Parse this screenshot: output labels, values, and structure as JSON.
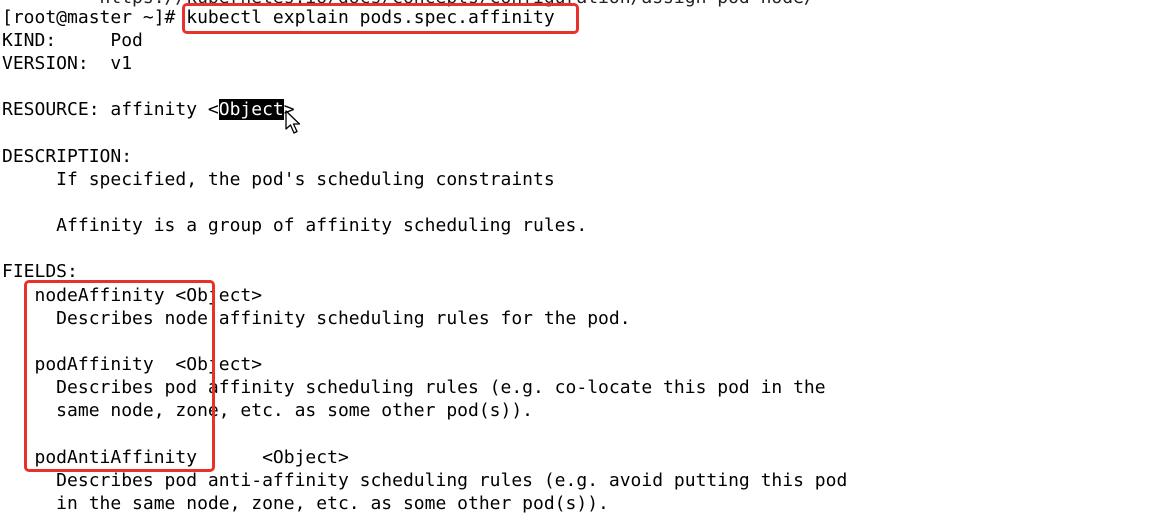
{
  "terminal": {
    "partial_top_line": "         https://kubernetes.io/docs/concepts/configuration/assign-pod-node/",
    "prompt": "[root@master ~]# ",
    "command": "kubectl explain pods.spec.affinity",
    "kind_line": "KIND:     Pod",
    "version_line": "VERSION:  v1",
    "resource_prefix": "RESOURCE: affinity <",
    "resource_type_selected": "Object",
    "resource_suffix": ">",
    "description_header": "DESCRIPTION:",
    "description_line1": "     If specified, the pod's scheduling constraints",
    "description_line2": "     Affinity is a group of affinity scheduling rules.",
    "fields_header": "FIELDS:",
    "fields": [
      {
        "line": "   nodeAffinity <Object>",
        "desc": [
          "     Describes node affinity scheduling rules for the pod."
        ]
      },
      {
        "line": "   podAffinity  <Object>",
        "desc": [
          "     Describes pod affinity scheduling rules (e.g. co-locate this pod in the",
          "     same node, zone, etc. as some other pod(s))."
        ]
      },
      {
        "line": "   podAntiAffinity      <Object>",
        "desc": [
          "     Describes pod anti-affinity scheduling rules (e.g. avoid putting this pod",
          "     in the same node, zone, etc. as some other pod(s))."
        ]
      }
    ]
  },
  "colors": {
    "annotation_box": "#e8312a",
    "background": "#ffffff",
    "text": "#000000"
  },
  "icons": {
    "cursor": "mouse-pointer-icon"
  }
}
